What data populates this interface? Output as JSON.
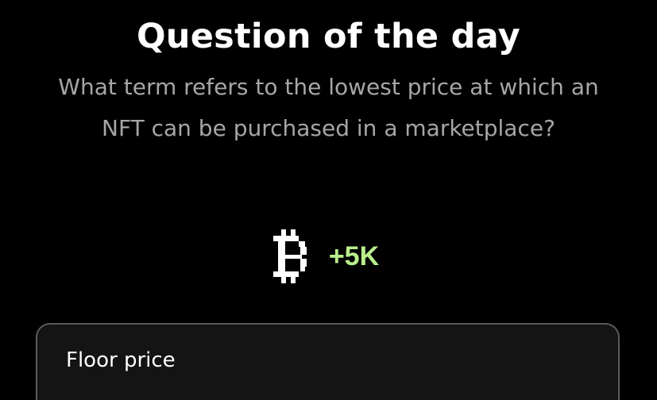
{
  "quiz": {
    "title": "Question of the day",
    "question": "What term refers to the lowest price at which an NFT can be purchased in a marketplace?",
    "reward": {
      "icon": "pixel-currency-icon",
      "amount": "+5K",
      "amount_color": "#b9ee8c"
    },
    "answers": [
      {
        "label": "Floor price"
      }
    ]
  }
}
